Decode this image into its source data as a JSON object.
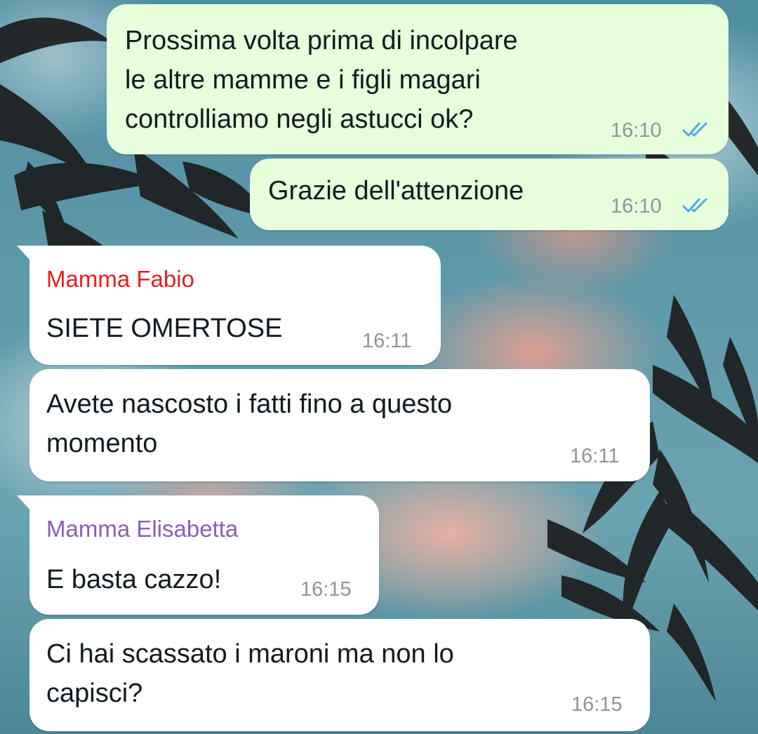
{
  "chat": {
    "messages": [
      {
        "direction": "outgoing",
        "text": "Prossima volta prima di incolpare\nle altre mamme e i figli magari\ncontrolliamo negli astucci ok?",
        "time": "16:10",
        "status": "read",
        "status_icon": "double-check-icon"
      },
      {
        "direction": "outgoing",
        "text": "Grazie dell'attenzione",
        "time": "16:10",
        "status": "read",
        "status_icon": "double-check-icon"
      },
      {
        "direction": "incoming",
        "sender": "Mamma Fabio",
        "text": "SIETE OMERTOSE",
        "time": "16:11"
      },
      {
        "direction": "incoming",
        "text": "Avete nascosto i fatti fino a questo\nmomento",
        "time": "16:11"
      },
      {
        "direction": "incoming",
        "sender": "Mamma Elisabetta",
        "text": "E basta cazzo!",
        "time": "16:15"
      },
      {
        "direction": "incoming",
        "text": "Ci hai scassato i maroni ma non lo\ncapisci?",
        "time": "16:15"
      }
    ]
  },
  "colors": {
    "outgoing_bubble": "#e7ffdb",
    "incoming_bubble": "#ffffff",
    "sender_mamma_fabio": "#e5201f",
    "sender_mamma_elisabetta": "#8a5fb0",
    "read_ticks": "#4fa8e8",
    "timestamp": "#8d9599"
  }
}
